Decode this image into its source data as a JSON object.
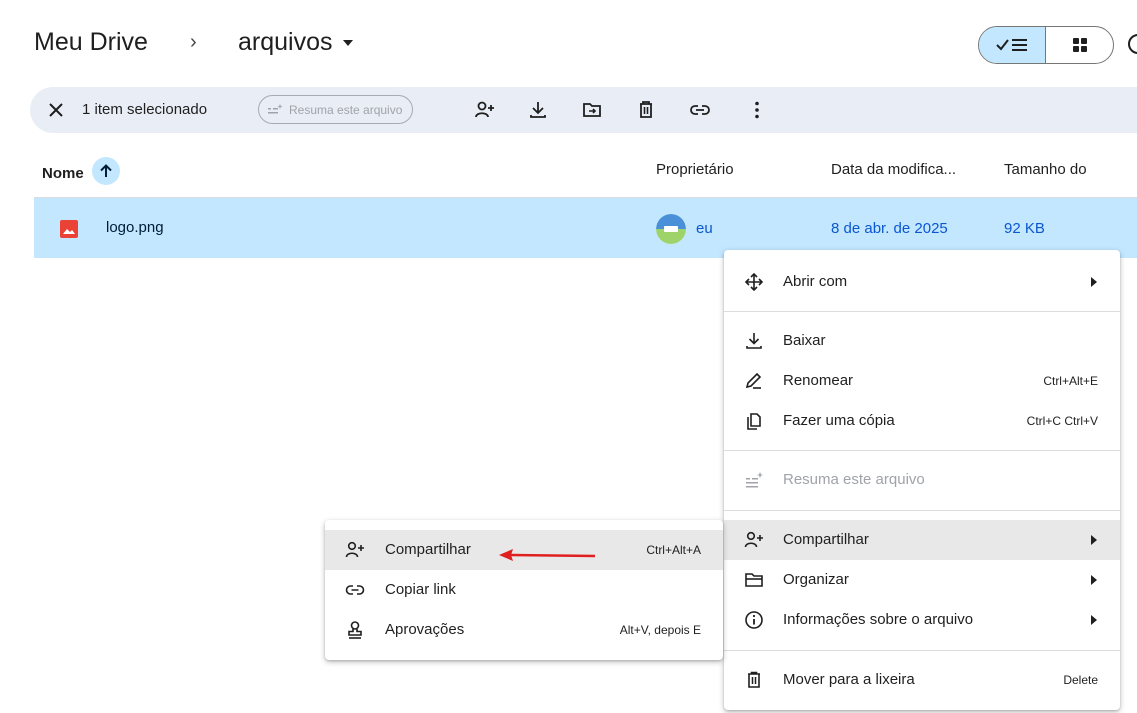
{
  "breadcrumb": {
    "root": "Meu Drive",
    "separator": "›",
    "folder": "arquivos"
  },
  "selection_bar": {
    "count_label": "1 item selecionado",
    "summarize_chip": "Resuma este arquivo"
  },
  "columns": {
    "name": "Nome",
    "owner": "Proprietário",
    "modified": "Data da modifica...",
    "size": "Tamanho do"
  },
  "file": {
    "name": "logo.png",
    "owner": "eu",
    "modified": "8 de abr. de 2025",
    "size": "92 KB"
  },
  "context_menu": {
    "open_with": "Abrir com",
    "download": "Baixar",
    "rename": "Renomear",
    "rename_shortcut": "Ctrl+Alt+E",
    "copy": "Fazer uma cópia",
    "copy_shortcut": "Ctrl+C Ctrl+V",
    "summarize": "Resuma este arquivo",
    "share": "Compartilhar",
    "organize": "Organizar",
    "file_info": "Informações sobre o arquivo",
    "trash": "Mover para a lixeira",
    "trash_shortcut": "Delete"
  },
  "share_submenu": {
    "share": "Compartilhar",
    "share_shortcut": "Ctrl+Alt+A",
    "copy_link": "Copiar link",
    "approvals": "Aprovações",
    "approvals_shortcut": "Alt+V, depois E"
  },
  "colors": {
    "selected_row": "#c2e7ff",
    "selection_bar": "#e9eef6",
    "link_blue": "#0b57d0",
    "annotation_arrow": "#e02020"
  }
}
